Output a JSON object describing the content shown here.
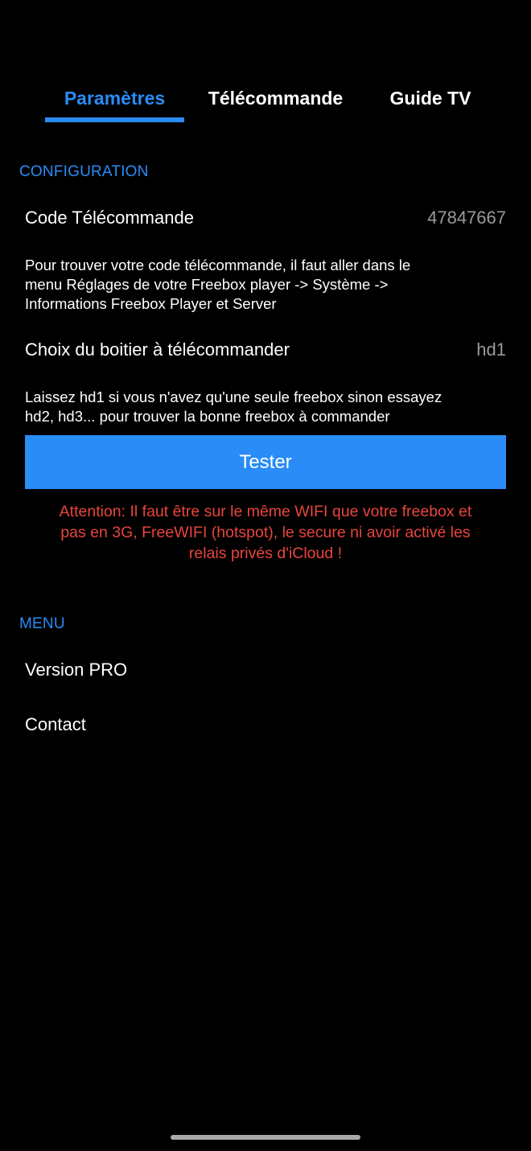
{
  "tabs": [
    {
      "label": "Paramètres",
      "active": true
    },
    {
      "label": "Télécommande",
      "active": false
    },
    {
      "label": "Guide TV",
      "active": false
    }
  ],
  "configuration": {
    "header": "CONFIGURATION",
    "remote_code": {
      "label": "Code Télécommande",
      "value": "47847667"
    },
    "remote_code_help": [
      "Pour trouver votre code télécommande, il faut aller  dans le",
      "menu Réglages de votre Freebox player -> Système ->",
      "Informations Freebox Player et Server"
    ],
    "box_choice": {
      "label": "Choix du boitier à télécommander",
      "value": "hd1"
    },
    "box_choice_help": [
      "Laissez hd1 si vous n'avez qu'une seule freebox sinon essayez",
      "hd2, hd3... pour trouver la bonne freebox à commander"
    ],
    "test_button": "Tester",
    "warning": [
      "Attention: Il faut être sur le même WIFI que votre freebox et",
      "pas en 3G, FreeWIFI (hotspot), le secure ni avoir activé les",
      "relais privés d'iCloud !"
    ]
  },
  "menu": {
    "header": "MENU",
    "items": [
      "Version PRO",
      "Contact"
    ]
  },
  "colors": {
    "accent": "#2a8cf6",
    "warning": "#e8453c",
    "background": "#000000",
    "secondary_text": "#9a9a9a"
  }
}
